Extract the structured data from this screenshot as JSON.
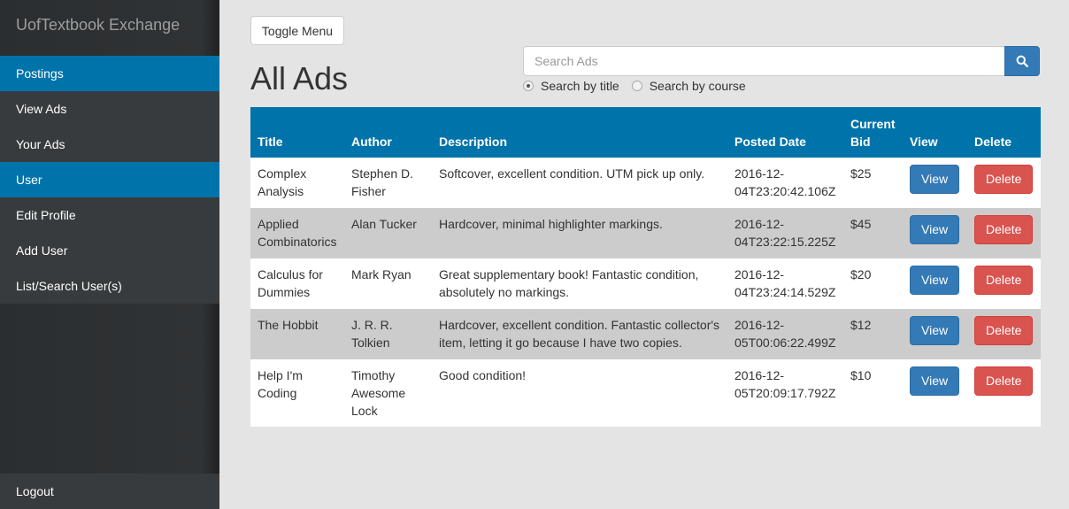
{
  "sidebar": {
    "brand": "UofTextbook Exchange",
    "items": [
      {
        "label": "Postings",
        "section": true
      },
      {
        "label": "View Ads",
        "section": false
      },
      {
        "label": "Your Ads",
        "section": false
      },
      {
        "label": "User",
        "section": true
      },
      {
        "label": "Edit Profile",
        "section": false
      },
      {
        "label": "Add User",
        "section": false
      },
      {
        "label": "List/Search User(s)",
        "section": false
      }
    ],
    "logout": "Logout"
  },
  "toolbar": {
    "toggle_label": "Toggle Menu"
  },
  "page": {
    "title": "All Ads"
  },
  "search": {
    "placeholder": "Search Ads",
    "value": "",
    "icon": "search-icon",
    "options": [
      {
        "label": "Search by title",
        "checked": true
      },
      {
        "label": "Search by course",
        "checked": false
      }
    ]
  },
  "table": {
    "headers": [
      "Title",
      "Author",
      "Description",
      "Posted Date",
      "Current Bid",
      "View",
      "Delete"
    ],
    "rows": [
      {
        "title": "Complex Analysis",
        "author": "Stephen D. Fisher",
        "description": "Softcover, excellent condition. UTM pick up only.",
        "date": "2016-12-04T23:20:42.106Z",
        "bid": "$25",
        "view": "View",
        "delete": "Delete"
      },
      {
        "title": "Applied Combinatorics",
        "author": "Alan Tucker",
        "description": "Hardcover, minimal highlighter markings.",
        "date": "2016-12-04T23:22:15.225Z",
        "bid": "$45",
        "view": "View",
        "delete": "Delete"
      },
      {
        "title": "Calculus for Dummies",
        "author": "Mark Ryan",
        "description": "Great supplementary book! Fantastic condition, absolutely no markings.",
        "date": "2016-12-04T23:24:14.529Z",
        "bid": "$20",
        "view": "View",
        "delete": "Delete"
      },
      {
        "title": "The Hobbit",
        "author": "J. R. R. Tolkien",
        "description": "Hardcover, excellent condition. Fantastic collector's item, letting it go because I have two copies.",
        "date": "2016-12-05T00:06:22.499Z",
        "bid": "$12",
        "view": "View",
        "delete": "Delete"
      },
      {
        "title": "Help I'm Coding",
        "author": "Timothy Awesome Lock",
        "description": "Good condition!",
        "date": "2016-12-05T20:09:17.792Z",
        "bid": "$10",
        "view": "View",
        "delete": "Delete"
      }
    ]
  },
  "colors": {
    "sidebar_bg": "#303335",
    "sidebar_active": "#0073aa",
    "table_header": "#0073aa",
    "primary_button": "#337ab7",
    "danger_button": "#d9534f",
    "page_bg": "#e4e4e4"
  }
}
